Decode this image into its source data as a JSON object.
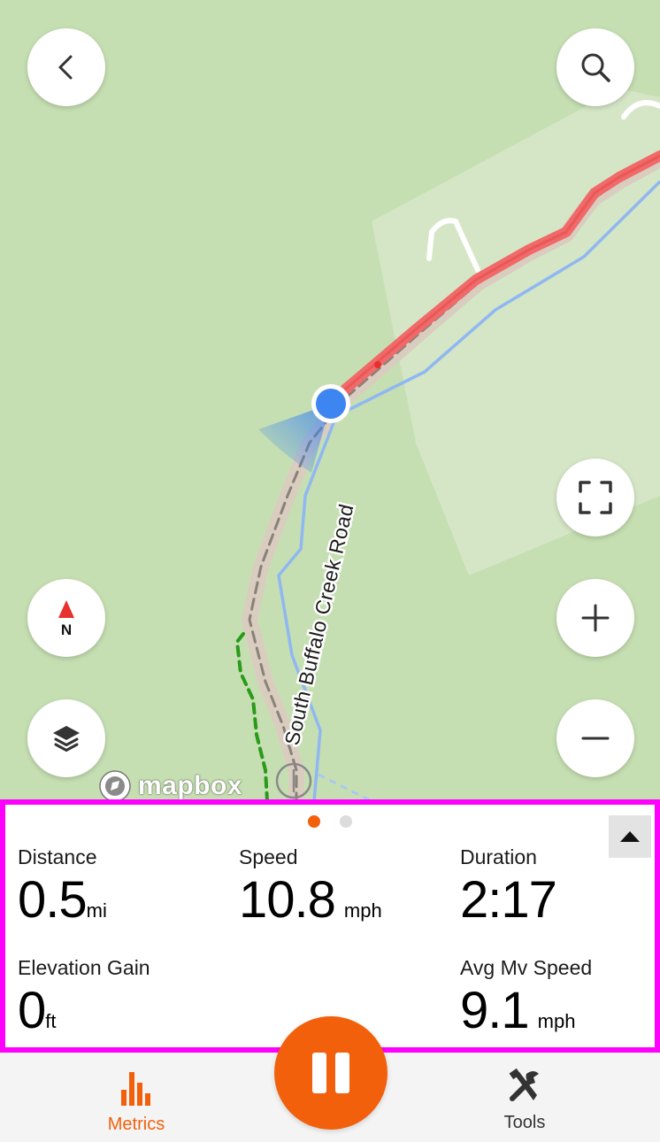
{
  "map": {
    "road_label": "South Buffalo Creek Road",
    "attribution": "mapbox",
    "controls": {
      "back": "chevron-left-icon",
      "search": "search-icon",
      "recenter": "fullscreen-icon",
      "compass": "N",
      "layers": "layers-icon",
      "zoom_in": "plus-icon",
      "zoom_out": "minus-icon"
    },
    "colors": {
      "land": "#c6dfb2",
      "track": "#f06a6a",
      "stream": "#8fb7f2",
      "trail": "#2a9a1a",
      "location": "#3d85f0"
    }
  },
  "panel": {
    "page_indicator": {
      "current": 1,
      "total": 2
    },
    "metrics": {
      "distance": {
        "label": "Distance",
        "value": "0.5",
        "unit": "mi"
      },
      "speed": {
        "label": "Speed",
        "value": "10.8",
        "unit": "mph"
      },
      "duration": {
        "label": "Duration",
        "value": "2:17",
        "unit": ""
      },
      "elevation_gain": {
        "label": "Elevation Gain",
        "value": "0",
        "unit": "ft"
      },
      "avg_mv_speed": {
        "label": "Avg Mv Speed",
        "value": "9.1",
        "unit": "mph"
      }
    }
  },
  "tabbar": {
    "metrics_label": "Metrics",
    "tools_label": "Tools"
  },
  "accent_color": "#f2600c",
  "highlight_color": "#ff00ff"
}
